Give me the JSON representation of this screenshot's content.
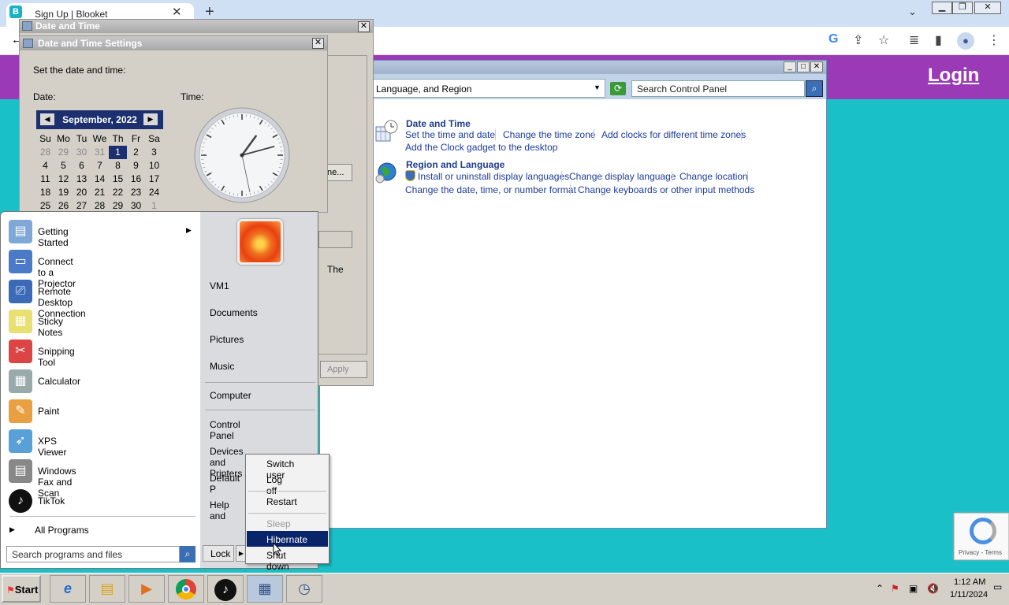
{
  "browser": {
    "tab_title": "Sign Up | Blooket",
    "favicon_letter": "B",
    "close_glyph": "✕",
    "new_tab_glyph": "+",
    "tabs_menu_glyph": "⌄",
    "window_buttons": [
      "▁",
      "❐",
      "✕"
    ],
    "toolbar_icons": [
      "G",
      "⇪",
      "☆",
      "≣",
      "▮",
      "⋮"
    ]
  },
  "page": {
    "login": "Login",
    "recaptcha_text": "Privacy - Terms",
    "header_color": "#9b3ab6",
    "background_color": "#19c0c8"
  },
  "control_panel": {
    "address_text": "Language, and Region",
    "search_placeholder": "Search Control Panel",
    "window_buttons": [
      "_",
      "□",
      "✕"
    ],
    "sections": [
      {
        "heading": "Date and Time",
        "links": [
          "Set the time and date",
          "Change the time zone",
          "Add clocks for different time zones",
          "Add the Clock gadget to the desktop"
        ]
      },
      {
        "heading": "Region and Language",
        "links": [
          "Install or uninstall display languages",
          "Change display language",
          "Change location",
          "Change the date, time, or number format",
          "Change keyboards or other input methods"
        ]
      }
    ]
  },
  "date_time_outer": {
    "title": "Date and Time",
    "change_button": "ne...",
    "partial_text": "The",
    "apply": "Apply"
  },
  "date_time_settings": {
    "title": "Date and Time Settings",
    "instruction": "Set the date and time:",
    "date_label": "Date:",
    "time_label": "Time:",
    "calendar": {
      "month": "September, 2022",
      "weekdays": [
        "Su",
        "Mo",
        "Tu",
        "We",
        "Th",
        "Fr",
        "Sa"
      ],
      "weeks": [
        [
          "28",
          "29",
          "30",
          "31",
          "1",
          "2",
          "3"
        ],
        [
          "4",
          "5",
          "6",
          "7",
          "8",
          "9",
          "10"
        ],
        [
          "11",
          "12",
          "13",
          "14",
          "15",
          "16",
          "17"
        ],
        [
          "18",
          "19",
          "20",
          "21",
          "22",
          "23",
          "24"
        ],
        [
          "25",
          "26",
          "27",
          "28",
          "29",
          "30",
          "1"
        ]
      ],
      "selected": "1"
    },
    "clock": {
      "hour": 1,
      "minute": 12,
      "second": 28
    }
  },
  "start_menu": {
    "programs": [
      "Getting Started",
      "Connect to a Projector",
      "Remote Desktop Connection",
      "Sticky Notes",
      "Snipping Tool",
      "Calculator",
      "Paint",
      "XPS Viewer",
      "Windows Fax and Scan",
      "TikTok"
    ],
    "all_programs": "All Programs",
    "search_placeholder": "Search programs and files",
    "right_items": [
      "VM1",
      "Documents",
      "Pictures",
      "Music",
      "Computer",
      "Control Panel",
      "Devices and Printers",
      "Default P",
      "Help and"
    ],
    "lock": "Lock"
  },
  "power_menu": {
    "items": [
      "Switch user",
      "Log off",
      "Restart",
      "Sleep",
      "Hibernate",
      "Shut down"
    ],
    "highlighted": "Hibernate",
    "disabled": "Sleep"
  },
  "taskbar": {
    "start": "Start",
    "time": "1:12 AM",
    "date": "1/11/2024",
    "tray_icons": [
      "⌃",
      "⚑",
      "▣",
      "🔇",
      "▭"
    ]
  }
}
